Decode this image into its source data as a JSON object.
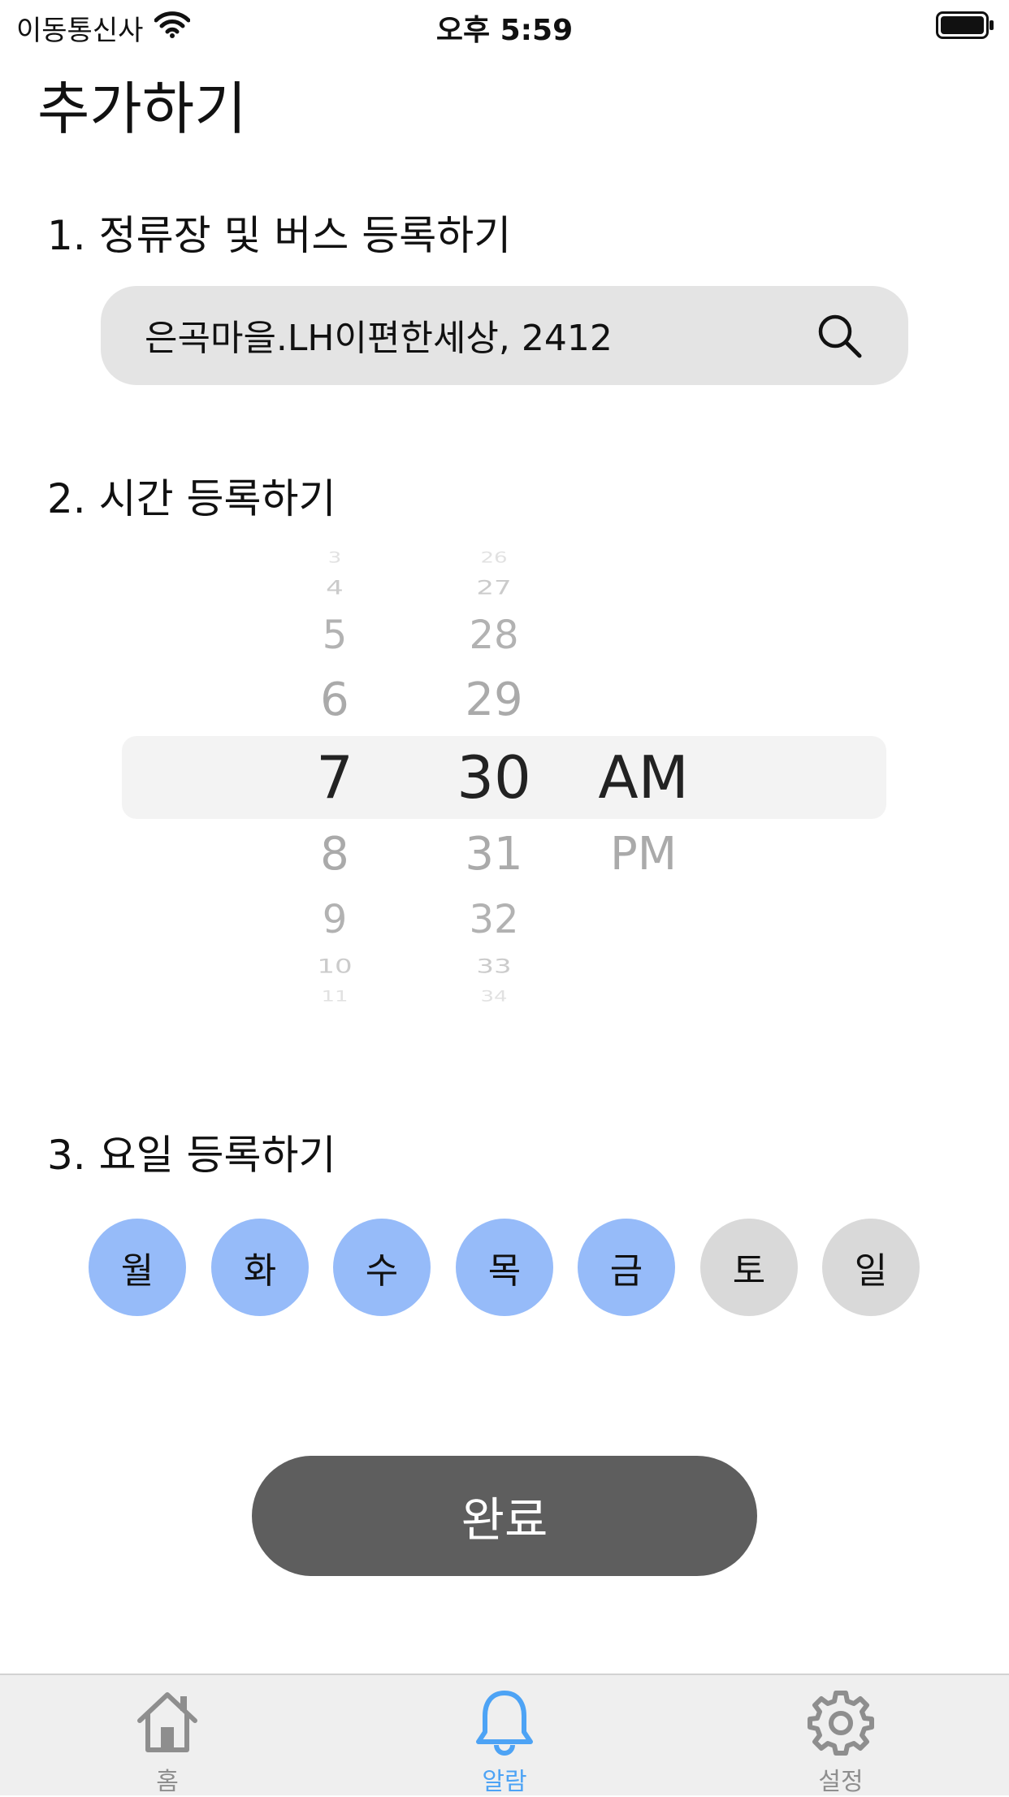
{
  "status_bar": {
    "carrier": "이동통신사",
    "time": "오후 5:59"
  },
  "page": {
    "title": "추가하기"
  },
  "section1": {
    "title": "1. 정류장 및 버스 등록하기",
    "search_value": "은곡마을.LH이편한세상, 2412",
    "search_icon": "search-icon"
  },
  "section2": {
    "title": "2. 시간 등록하기",
    "hours": [
      "3",
      "4",
      "5",
      "6",
      "7",
      "8",
      "9",
      "10",
      "11"
    ],
    "minutes": [
      "26",
      "27",
      "28",
      "29",
      "30",
      "31",
      "32",
      "33",
      "34"
    ],
    "ampm": [
      "AM",
      "PM"
    ],
    "selected": {
      "hour": "7",
      "minute": "30",
      "ampm": "AM"
    }
  },
  "section3": {
    "title": "3. 요일 등록하기",
    "days": [
      {
        "label": "월",
        "selected": true
      },
      {
        "label": "화",
        "selected": true
      },
      {
        "label": "수",
        "selected": true
      },
      {
        "label": "목",
        "selected": true
      },
      {
        "label": "금",
        "selected": true
      },
      {
        "label": "토",
        "selected": false
      },
      {
        "label": "일",
        "selected": false
      }
    ],
    "selected_color": "#96bbf9",
    "unselected_color": "#d9d9d9"
  },
  "done_button": {
    "label": "완료",
    "color": "#5e5e5e"
  },
  "tabbar": {
    "items": [
      {
        "label": "홈",
        "icon": "home-icon",
        "active": false
      },
      {
        "label": "알람",
        "icon": "bell-icon",
        "active": true
      },
      {
        "label": "설정",
        "icon": "gear-icon",
        "active": false
      }
    ],
    "active_color": "#4da3f5",
    "inactive_color": "#8e8e8e"
  }
}
